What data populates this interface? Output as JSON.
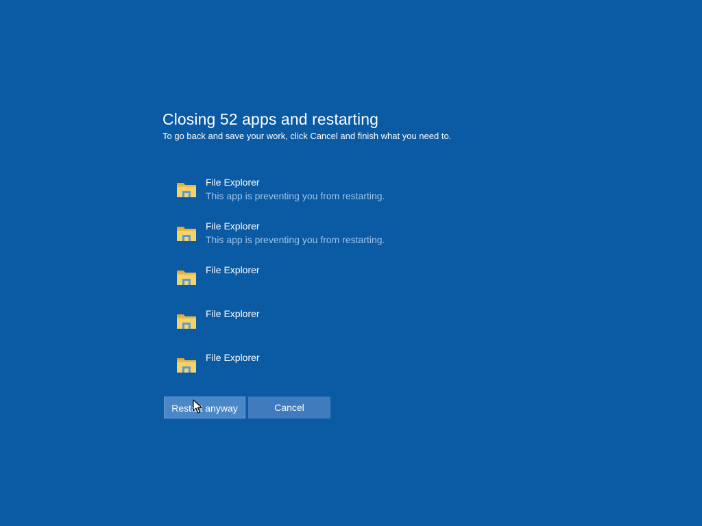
{
  "dialog": {
    "title": "Closing 52 apps and restarting",
    "subtitle": "To go back and save your work, click Cancel and finish what you need to."
  },
  "apps": [
    {
      "name": "File Explorer",
      "status": "This app is preventing you from restarting.",
      "icon": "file-explorer-icon"
    },
    {
      "name": "File Explorer",
      "status": "This app is preventing you from restarting.",
      "icon": "file-explorer-icon"
    },
    {
      "name": "File Explorer",
      "status": "",
      "icon": "file-explorer-icon"
    },
    {
      "name": "File Explorer",
      "status": "",
      "icon": "file-explorer-icon"
    },
    {
      "name": "File Explorer",
      "status": "",
      "icon": "file-explorer-icon"
    }
  ],
  "buttons": {
    "restart_label": "Restart anyway",
    "cancel_label": "Cancel"
  },
  "colors": {
    "background": "#0b5aa4",
    "status_text": "#9cc4ec",
    "restart_button": "#4a87c6",
    "cancel_button": "#3f7bbd"
  }
}
